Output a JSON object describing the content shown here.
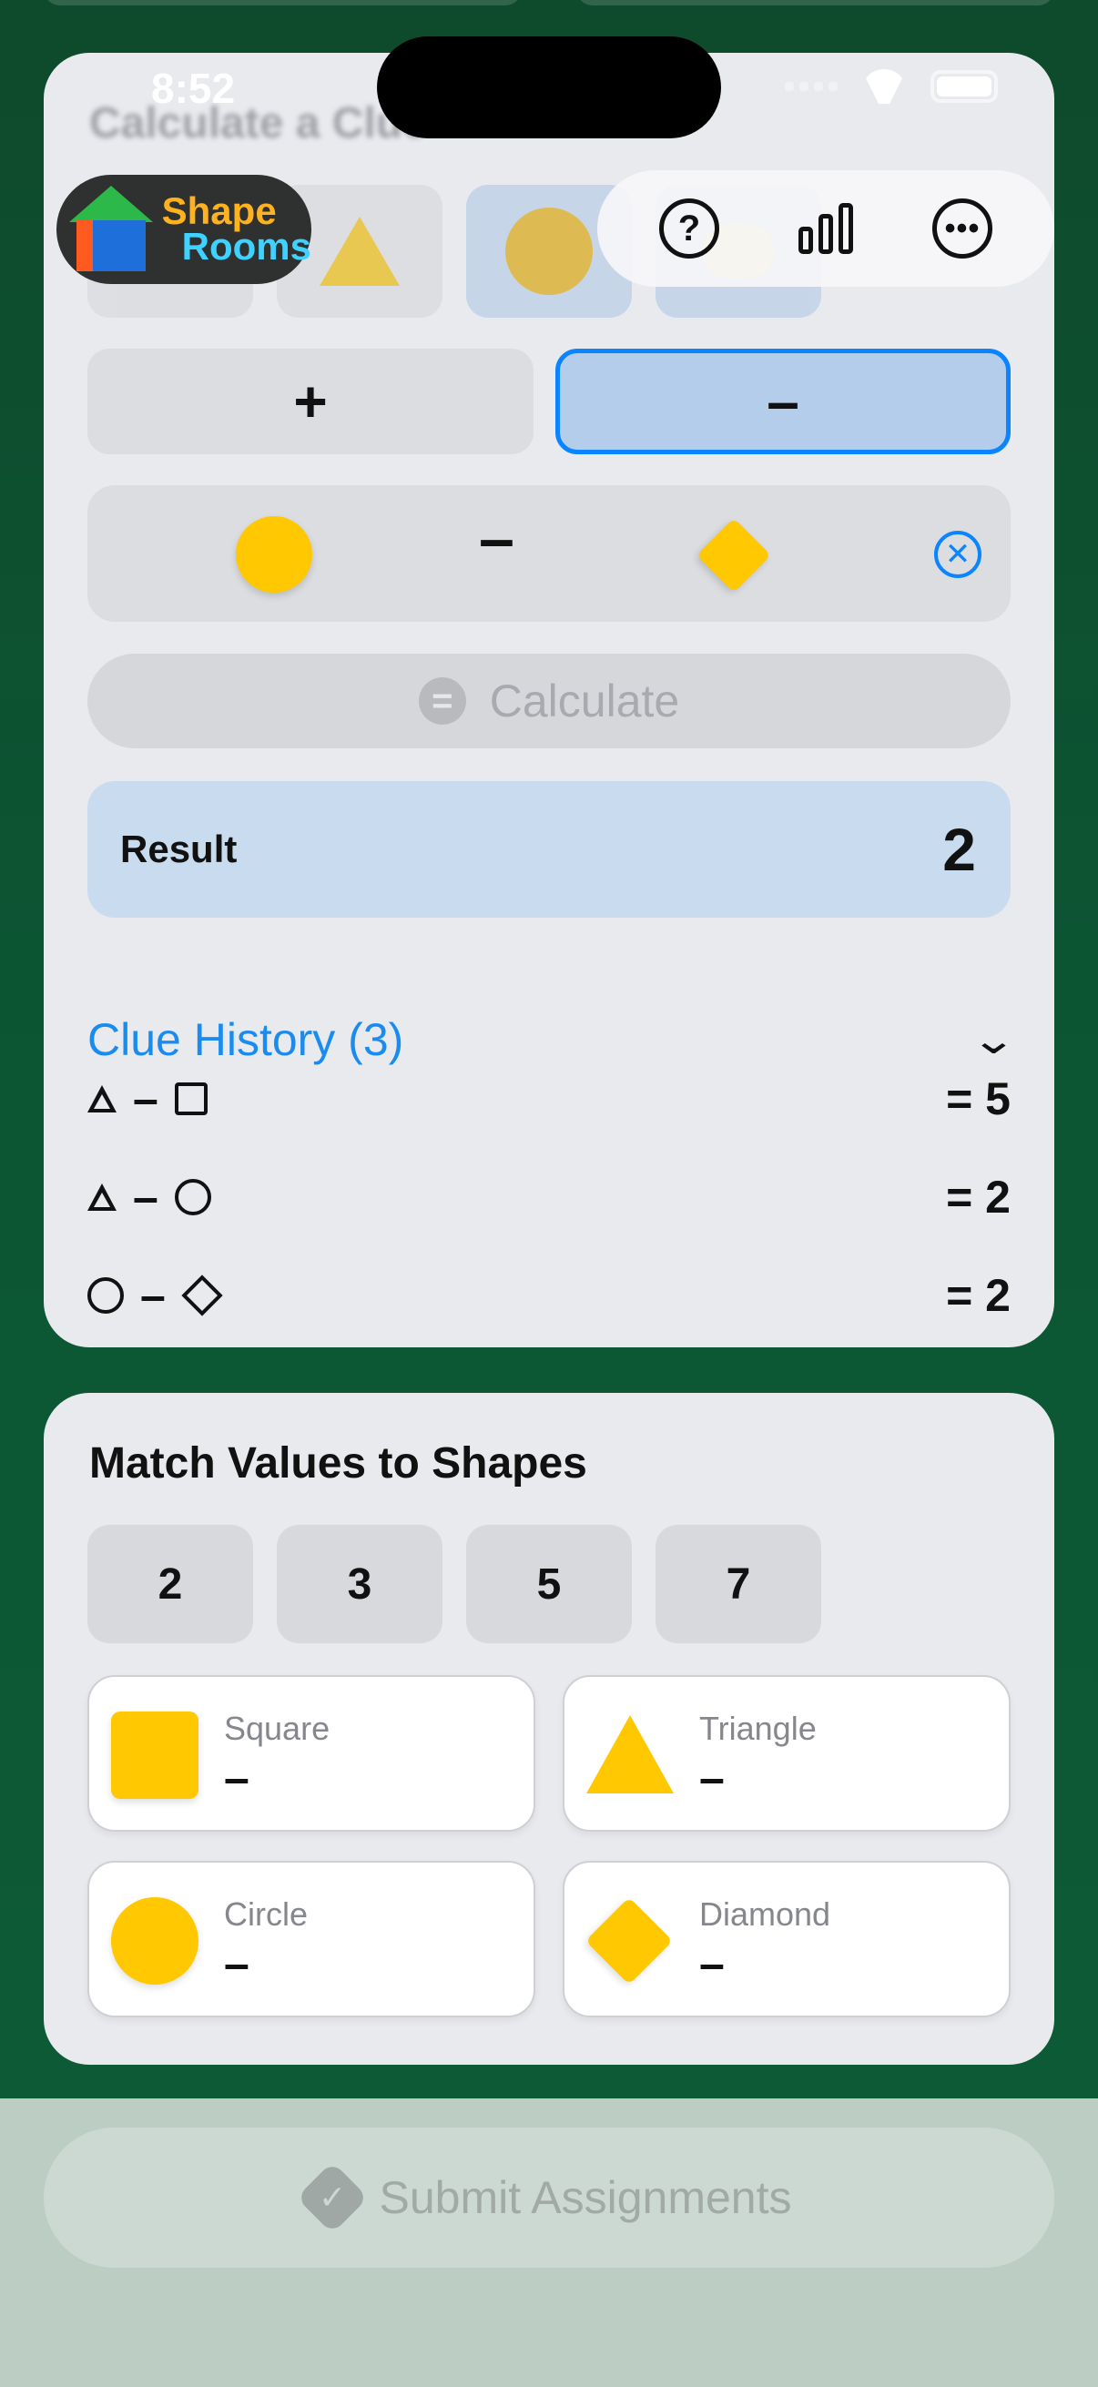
{
  "status_bar": {
    "time": "8:52"
  },
  "app": {
    "logo_line1": "Shape",
    "logo_line2": "Rooms"
  },
  "toolbar": {
    "help_glyph": "?",
    "more_glyph": "•••"
  },
  "calculator": {
    "title": "Calculate a Clue",
    "operators": [
      {
        "label": "+",
        "selected": false
      },
      {
        "label": "–",
        "selected": true
      }
    ],
    "expression": {
      "left_shape": "circle",
      "operator": "–",
      "right_shape": "diamond",
      "clear_glyph": "✕"
    },
    "calculate_label": "Calculate",
    "calculate_icon": "=",
    "result_label": "Result",
    "result_value": "2"
  },
  "history": {
    "title": "Clue History (3)",
    "chevron": "⌄",
    "clues": [
      {
        "left": "triangle",
        "operator": "–",
        "right": "square",
        "result": "= 5"
      },
      {
        "left": "triangle",
        "operator": "–",
        "right": "circle",
        "result": "= 2"
      },
      {
        "left": "circle",
        "operator": "–",
        "right": "diamond",
        "result": "= 2"
      }
    ]
  },
  "match": {
    "title": "Match Values to Shapes",
    "values": [
      "2",
      "3",
      "5",
      "7"
    ],
    "slots": [
      {
        "name": "Square",
        "value": "–"
      },
      {
        "name": "Triangle",
        "value": "–"
      },
      {
        "name": "Circle",
        "value": "–"
      },
      {
        "name": "Diamond",
        "value": "–"
      }
    ]
  },
  "submit": {
    "label": "Submit Assignments",
    "icon_glyph": "✓"
  },
  "colors": {
    "accent": "#0a84ff",
    "shape_yellow": "#ffc800",
    "background_green": "#0d5a36"
  }
}
